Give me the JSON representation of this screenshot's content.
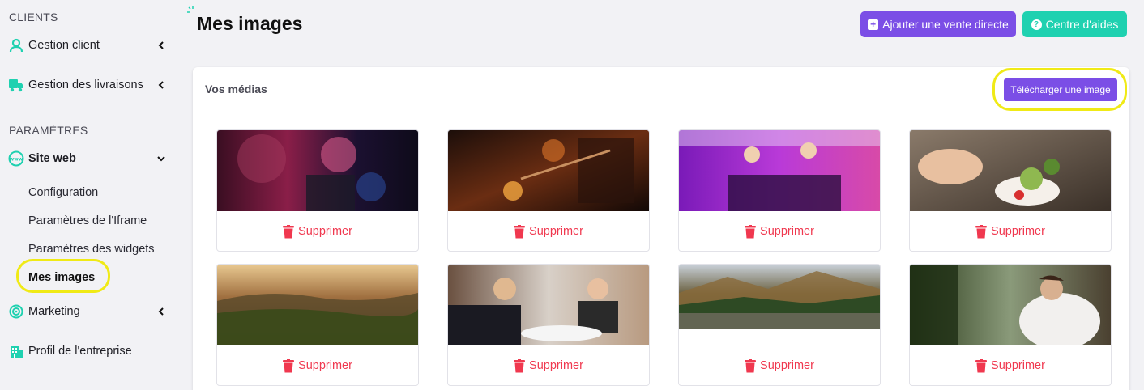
{
  "sidebar": {
    "section_clients": "CLIENTS",
    "gestion_client": "Gestion client",
    "gestion_livraisons": "Gestion des livraisons",
    "section_parametres": "PARAMÈTRES",
    "site_web": "Site web",
    "sub_items": [
      "Configuration",
      "Paramètres de l'Iframe",
      "Paramètres des widgets",
      "Mes images"
    ],
    "marketing": "Marketing",
    "profil": "Profil de l'entreprise"
  },
  "header": {
    "title": "Mes images",
    "btn_vente": "Ajouter une vente directe",
    "btn_aide": "Centre d'aides"
  },
  "card": {
    "title": "Vos médias",
    "upload_label": "Télécharger une image",
    "delete_label": "Supprimer"
  },
  "colors": {
    "accent_purple": "#7b4ee6",
    "accent_teal": "#1fd1b0",
    "delete_red": "#f0384f",
    "highlight": "#f0ea16"
  }
}
